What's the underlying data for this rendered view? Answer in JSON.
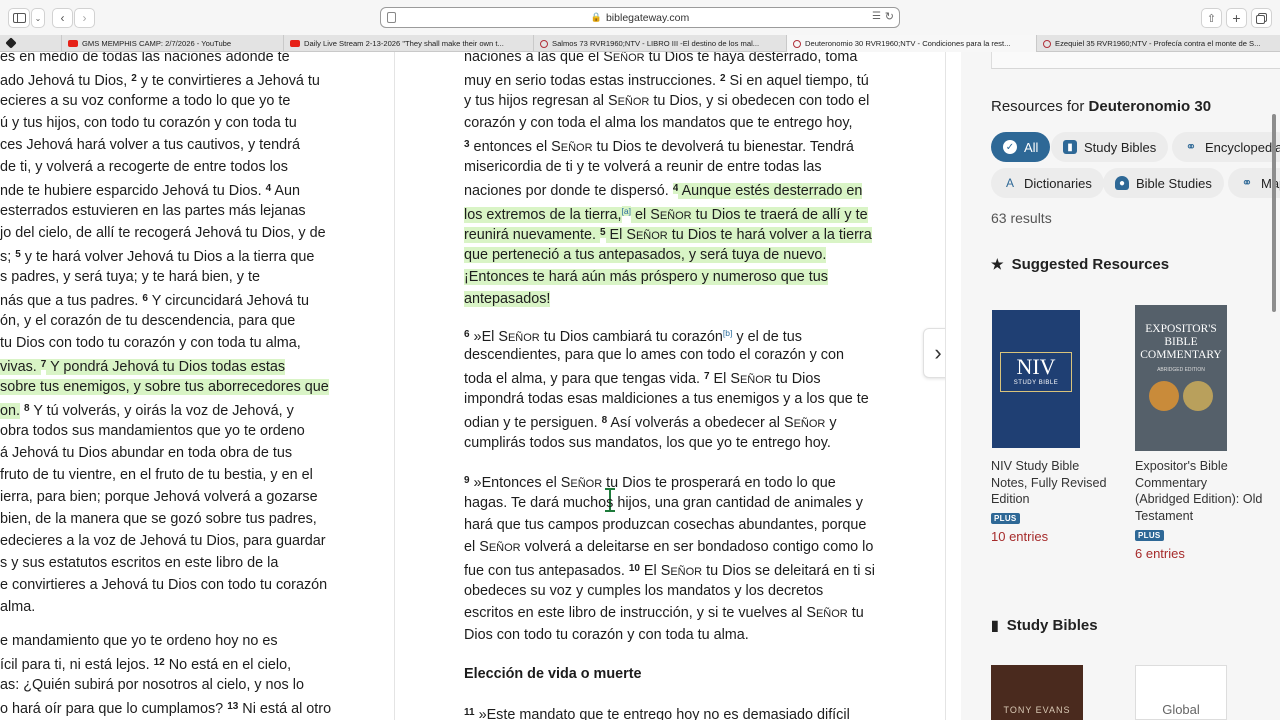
{
  "browser": {
    "url": "biblegateway.com",
    "tabs": [
      {
        "title": "GMS MEMPHIS CAMP: 2/7/2026 - YouTube",
        "kind": "yt"
      },
      {
        "title": "Daily Live Stream 2-13-2026 \"They shall make their own t...",
        "kind": "yt"
      },
      {
        "title": "Salmos 73 RVR1960;NTV - LIBRO III -El destino de los mal...",
        "kind": "bg"
      },
      {
        "title": "Deuteronomio 30 RVR1960;NTV - Condiciones para la rest...",
        "kind": "bg",
        "active": true
      },
      {
        "title": "Ezequiel 35 RVR1960;NTV - Profecía contra el monte de S...",
        "kind": "bg"
      }
    ]
  },
  "left_column": {
    "lines": [
      {
        "segments": [
          {
            "t": "es en medio de todas las naciones adonde te"
          }
        ]
      },
      {
        "segments": [
          {
            "t": "ado Jehová tu Dios, "
          },
          {
            "t": "2",
            "v": true
          },
          {
            "t": " y te convirtieres a Jehová tu"
          }
        ]
      },
      {
        "segments": [
          {
            "t": "ecieres a su voz conforme a todo lo que yo te"
          }
        ]
      },
      {
        "segments": [
          {
            "t": "ú y tus hijos, con todo tu corazón y con toda tu"
          }
        ]
      },
      {
        "segments": [
          {
            "t": "ces Jehová hará volver a tus cautivos, y tendrá"
          }
        ]
      },
      {
        "segments": [
          {
            "t": "de ti, y volverá a recogerte de entre todos los"
          }
        ]
      },
      {
        "segments": [
          {
            "t": "nde te hubiere esparcido Jehová tu Dios. "
          },
          {
            "t": "4",
            "v": true
          },
          {
            "t": " Aun"
          }
        ]
      },
      {
        "segments": [
          {
            "t": "esterrados estuvieren en las partes más lejanas"
          }
        ]
      },
      {
        "segments": [
          {
            "t": "jo del cielo, de allí te recogerá Jehová tu Dios, y de"
          }
        ]
      },
      {
        "segments": [
          {
            "t": "s; "
          },
          {
            "t": "5",
            "v": true
          },
          {
            "t": " y te hará volver Jehová tu Dios a la tierra que"
          }
        ]
      },
      {
        "segments": [
          {
            "t": "s padres, y será tuya; y te hará bien, y te"
          }
        ]
      },
      {
        "segments": [
          {
            "t": "nás que a tus padres. "
          },
          {
            "t": "6",
            "v": true
          },
          {
            "t": " Y circuncidará Jehová tu"
          }
        ]
      },
      {
        "segments": [
          {
            "t": "ón, y el corazón de tu descendencia, para que"
          }
        ]
      },
      {
        "segments": [
          {
            "t": " tu Dios con todo tu corazón y con toda tu alma,"
          }
        ]
      },
      {
        "segments": [
          {
            "t": "vivas. ",
            "hl": true
          },
          {
            "t": "7",
            "v": true,
            "hl": true
          },
          {
            "t": " Y pondrá Jehová tu Dios todas estas",
            "hl": true
          }
        ]
      },
      {
        "segments": [
          {
            "t": "sobre tus enemigos, y sobre tus aborrecedores que",
            "hl": true
          }
        ]
      },
      {
        "segments": [
          {
            "t": "on.",
            "hl": true
          },
          {
            "t": " "
          },
          {
            "t": "8",
            "v": true
          },
          {
            "t": " Y tú volverás, y oirás la voz de Jehová, y"
          }
        ]
      },
      {
        "segments": [
          {
            "t": "obra todos sus mandamientos que yo te ordeno"
          }
        ]
      },
      {
        "segments": [
          {
            "t": "á Jehová tu Dios abundar en toda obra de tus"
          }
        ]
      },
      {
        "segments": [
          {
            "t": " fruto de tu vientre, en el fruto de tu bestia, y en el"
          }
        ]
      },
      {
        "segments": [
          {
            "t": "ierra, para bien; porque Jehová volverá a gozarse"
          }
        ]
      },
      {
        "segments": [
          {
            "t": "bien, de la manera que se gozó sobre tus padres,"
          }
        ]
      },
      {
        "segments": [
          {
            "t": "edecieres a la voz de Jehová tu Dios, para guardar"
          }
        ]
      },
      {
        "segments": [
          {
            "t": "s y sus estatutos escritos en este libro de la"
          }
        ]
      },
      {
        "segments": [
          {
            "t": "e convirtieres a Jehová tu Dios con todo tu corazón"
          }
        ]
      },
      {
        "segments": [
          {
            "t": " alma."
          }
        ]
      },
      {
        "segments": [
          {
            "t": "e mandamiento que yo te ordeno hoy no es"
          }
        ]
      },
      {
        "segments": [
          {
            "t": "ícil para ti, ni está lejos. "
          },
          {
            "t": "12",
            "v": true
          },
          {
            "t": " No está en el cielo,"
          }
        ]
      },
      {
        "segments": [
          {
            "t": "as: ¿Quién subirá por nosotros al cielo, y nos lo"
          }
        ]
      },
      {
        "segments": [
          {
            "t": "o hará oír para que lo cumplamos? "
          },
          {
            "t": "13",
            "v": true
          },
          {
            "t": " Ni está al otro"
          }
        ]
      }
    ]
  },
  "middle_column": {
    "lines": [
      {
        "segments": [
          {
            "t": "naciones a las que el Señor tu Dios te haya desterrado, toma"
          }
        ]
      },
      {
        "segments": [
          {
            "t": "muy en serio todas estas instrucciones. "
          },
          {
            "t": "2",
            "v": true
          },
          {
            "t": " Si en aquel tiempo, tú"
          }
        ]
      },
      {
        "segments": [
          {
            "t": "y tus hijos regresan al Señor tu Dios, y si obedecen con todo el"
          }
        ]
      },
      {
        "segments": [
          {
            "t": "corazón y con toda el alma los mandatos que te entrego hoy,"
          }
        ]
      },
      {
        "segments": [
          {
            "t": "3",
            "v": true
          },
          {
            "t": " entonces el Señor tu Dios te devolverá tu bienestar. Tendrá"
          }
        ]
      },
      {
        "segments": [
          {
            "t": "misericordia de ti y te volverá a reunir de entre todas las"
          }
        ]
      },
      {
        "segments": [
          {
            "t": "naciones por donde te dispersó. "
          },
          {
            "t": "4",
            "v": true,
            "hl": true
          },
          {
            "t": " Aunque estés desterrado en",
            "hl": true
          }
        ]
      },
      {
        "segments": [
          {
            "t": "los extremos de la tierra,",
            "hl": true
          },
          {
            "t": "[a]",
            "fn": true,
            "hl": true
          },
          {
            "t": " el Señor tu Dios te traerá de allí y te",
            "hl": true
          }
        ]
      },
      {
        "segments": [
          {
            "t": "reunirá nuevamente. ",
            "hl": true
          },
          {
            "t": "5",
            "v": true,
            "hl": true
          },
          {
            "t": " El Señor tu Dios te hará volver a la tierra",
            "hl": true
          }
        ]
      },
      {
        "segments": [
          {
            "t": "que perteneció a tus antepasados, y será tuya de nuevo.",
            "hl": true
          }
        ]
      },
      {
        "segments": [
          {
            "t": "¡Entonces te hará aún más próspero y numeroso que tus",
            "hl": true
          }
        ]
      },
      {
        "segments": [
          {
            "t": "antepasados!",
            "hl": true
          }
        ]
      },
      {
        "segments": [
          {
            "t": "6",
            "v": true
          },
          {
            "t": " »El Señor tu Dios cambiará tu corazón"
          },
          {
            "t": "[b]",
            "fn": true
          },
          {
            "t": " y el de tus"
          }
        ]
      },
      {
        "segments": [
          {
            "t": "descendientes, para que lo ames con todo el corazón y con"
          }
        ]
      },
      {
        "segments": [
          {
            "t": "toda el alma, y para que tengas vida. "
          },
          {
            "t": "7",
            "v": true
          },
          {
            "t": " El Señor tu Dios"
          }
        ]
      },
      {
        "segments": [
          {
            "t": "impondrá todas esas maldiciones a tus enemigos y a los que te"
          }
        ]
      },
      {
        "segments": [
          {
            "t": "odian y te persiguen. "
          },
          {
            "t": "8",
            "v": true
          },
          {
            "t": " Así volverás a obedecer al Señor y"
          }
        ]
      },
      {
        "segments": [
          {
            "t": "cumplirás todos sus mandatos, los que yo te entrego hoy."
          }
        ]
      },
      {
        "segments": [
          {
            "t": "9",
            "v": true
          },
          {
            "t": " »Entonces el Señor tu Dios te prosperará en todo lo que"
          }
        ]
      },
      {
        "segments": [
          {
            "t": "hagas. Te dará muchos hijos, una gran cantidad de animales y"
          }
        ]
      },
      {
        "segments": [
          {
            "t": "hará que tus campos produzcan cosechas abundantes, porque"
          }
        ]
      },
      {
        "segments": [
          {
            "t": "el Señor volverá a deleitarse en ser bondadoso contigo como lo"
          }
        ]
      },
      {
        "segments": [
          {
            "t": "fue con tus antepasados. "
          },
          {
            "t": "10",
            "v": true
          },
          {
            "t": " El Señor tu Dios se deleitará en ti si"
          }
        ]
      },
      {
        "segments": [
          {
            "t": "obedeces su voz y cumples los mandatos y los decretos"
          }
        ]
      },
      {
        "segments": [
          {
            "t": "escritos en este libro de instrucción, y si te vuelves al Señor tu"
          }
        ]
      },
      {
        "segments": [
          {
            "t": "Dios con todo tu corazón y con toda tu alma."
          }
        ]
      },
      {
        "segments": [
          {
            "t": "11",
            "v": true
          },
          {
            "t": " »Este mandato que te entrego hoy no es demasiado difícil"
          }
        ]
      }
    ],
    "section_heading": "Elección de vida o muerte"
  },
  "sidebar": {
    "resources_prefix": "Resources for",
    "resources_passage": "Deuteronomio 30",
    "filters": [
      {
        "label": "All",
        "icon": "check-icon",
        "active": true
      },
      {
        "label": "Study Bibles",
        "icon": "book-icon"
      },
      {
        "label": "Encyclopedias",
        "icon": "globe-icon"
      },
      {
        "label": "Dictionaries",
        "icon": "dictionary-icon"
      },
      {
        "label": "Bible Studies",
        "icon": "person-icon"
      },
      {
        "label": "Maps",
        "icon": "globe-icon"
      }
    ],
    "results_count": "63 results",
    "suggested_heading": "Suggested Resources",
    "books": [
      {
        "title": "NIV Study Bible Notes, Fully Revised Edition",
        "badge": "PLUS",
        "entries": "10 entries",
        "cover_color": "#1f3f73"
      },
      {
        "title": "Expositor's Bible Commentary (Abridged Edition): Old Testament",
        "badge": "PLUS",
        "entries": "6 entries",
        "cover_color": "#55606a"
      }
    ],
    "niv_cover": {
      "brand": "NIV",
      "sub": "STUDY BIBLE"
    },
    "expositor_cover": {
      "line1": "EXPOSITOR'S",
      "line2": "BIBLE",
      "line3": "COMMENTARY",
      "edition": "ABRIDGED EDITION"
    },
    "study_bibles_heading": "Study Bibles",
    "thumbs": [
      {
        "text": "TONY EVANS"
      },
      {
        "text": "Global"
      }
    ]
  }
}
